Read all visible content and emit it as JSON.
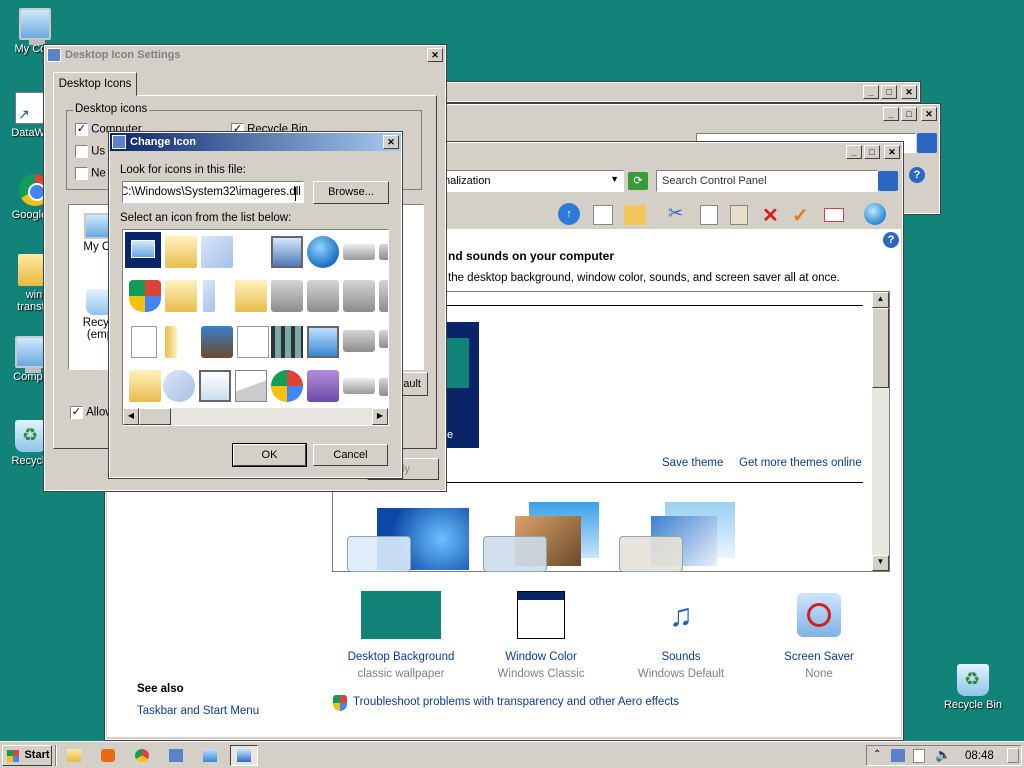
{
  "desktop": {
    "icons": [
      {
        "label": "My Com",
        "icon": "computer-icon"
      },
      {
        "label": "DataWa",
        "icon": "shortcut-icon"
      },
      {
        "label": "Google C",
        "icon": "chrome-icon"
      },
      {
        "label": "win transfo",
        "icon": "folder-icon"
      },
      {
        "label": "Compu",
        "icon": "computer-icon"
      },
      {
        "label": "Recycle",
        "icon": "recycle-bin-icon"
      }
    ],
    "recycle_bin_right": "Recycle Bin"
  },
  "desktop_icon_settings": {
    "title": "Desktop Icon Settings",
    "tab": "Desktop Icons",
    "group_label": "Desktop icons",
    "checkboxes": [
      {
        "label": "Computer",
        "checked": true
      },
      {
        "label": "Recycle Bin",
        "checked": true
      },
      {
        "label": "Us",
        "checked": false
      },
      {
        "label": "Ne",
        "checked": false
      }
    ],
    "list_items": [
      "My Co",
      "Recycl (emp"
    ],
    "allow_label": "Allow",
    "allow_checked": true,
    "restore_fragment": "ault",
    "apply_fragment": "ply"
  },
  "change_icon": {
    "title": "Change Icon",
    "look_label": "Look for icons in this file:",
    "file_value": "C:\\Windows\\System32\\imageres.dll",
    "browse_label": "Browse...",
    "select_label": "Select an icon from the list below:",
    "ok_label": "OK",
    "cancel_label": "Cancel"
  },
  "personalization": {
    "address_text": "nalization",
    "search_placeholder": "Search Control Panel",
    "heading": "nd sounds on your computer",
    "subheading": "the desktop background, window color, sounds, and screen saver all at once.",
    "save_theme": "Save theme",
    "get_more": "Get more themes online",
    "theme_label_fragment": "e",
    "items": [
      {
        "title": "Desktop Background",
        "sub": "classic wallpaper"
      },
      {
        "title": "Window Color",
        "sub": "Windows Classic"
      },
      {
        "title": "Sounds",
        "sub": "Windows Default"
      },
      {
        "title": "Screen Saver",
        "sub": "None"
      }
    ],
    "see_also": "See also",
    "taskbar_link": "Taskbar and Start Menu",
    "troubleshoot_link": "Troubleshoot problems with transparency and other Aero effects",
    "accent": "#118379"
  },
  "taskbar": {
    "start_label": "Start",
    "clock": "08:48"
  }
}
